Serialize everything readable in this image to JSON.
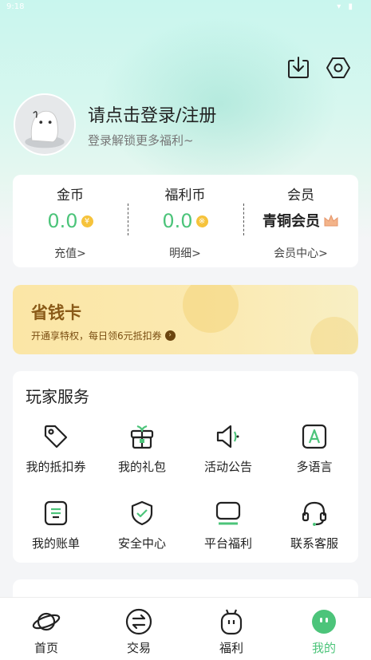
{
  "status_bar": {
    "time": "9:18",
    "icons": "▾ ▮"
  },
  "header": {
    "login_title": "请点击登录/注册",
    "login_subtitle": "登录解锁更多福利~"
  },
  "stats": [
    {
      "label": "金币",
      "value": "0.0",
      "badge": "¥",
      "link": "充值>"
    },
    {
      "label": "福利币",
      "value": "0.0",
      "badge": "※",
      "link": "明细>"
    },
    {
      "label": "会员",
      "value": "青铜会员",
      "link": "会员中心>"
    }
  ],
  "saving_card": {
    "title": "省钱卡",
    "subtitle": "开通享特权，每日领6元抵扣券",
    "arrow": "›"
  },
  "services": {
    "title": "玩家服务",
    "items": [
      {
        "label": "我的抵扣券",
        "icon": "coupon-tag-icon"
      },
      {
        "label": "我的礼包",
        "icon": "gift-icon"
      },
      {
        "label": "活动公告",
        "icon": "speaker-icon"
      },
      {
        "label": "多语言",
        "icon": "language-icon"
      },
      {
        "label": "我的账单",
        "icon": "bill-icon"
      },
      {
        "label": "安全中心",
        "icon": "shield-icon"
      },
      {
        "label": "平台福利",
        "icon": "platform-icon"
      },
      {
        "label": "联系客服",
        "icon": "headset-icon"
      }
    ]
  },
  "bottom_nav": {
    "items": [
      {
        "label": "首页",
        "icon": "planet-icon"
      },
      {
        "label": "交易",
        "icon": "exchange-icon"
      },
      {
        "label": "福利",
        "icon": "welfare-icon"
      },
      {
        "label": "我的",
        "icon": "profile-face-icon",
        "active": true
      }
    ]
  },
  "colors": {
    "accent_green": "#4cc47a",
    "coin_gold": "#f6c33b",
    "saving_brown": "#8a5a18"
  }
}
